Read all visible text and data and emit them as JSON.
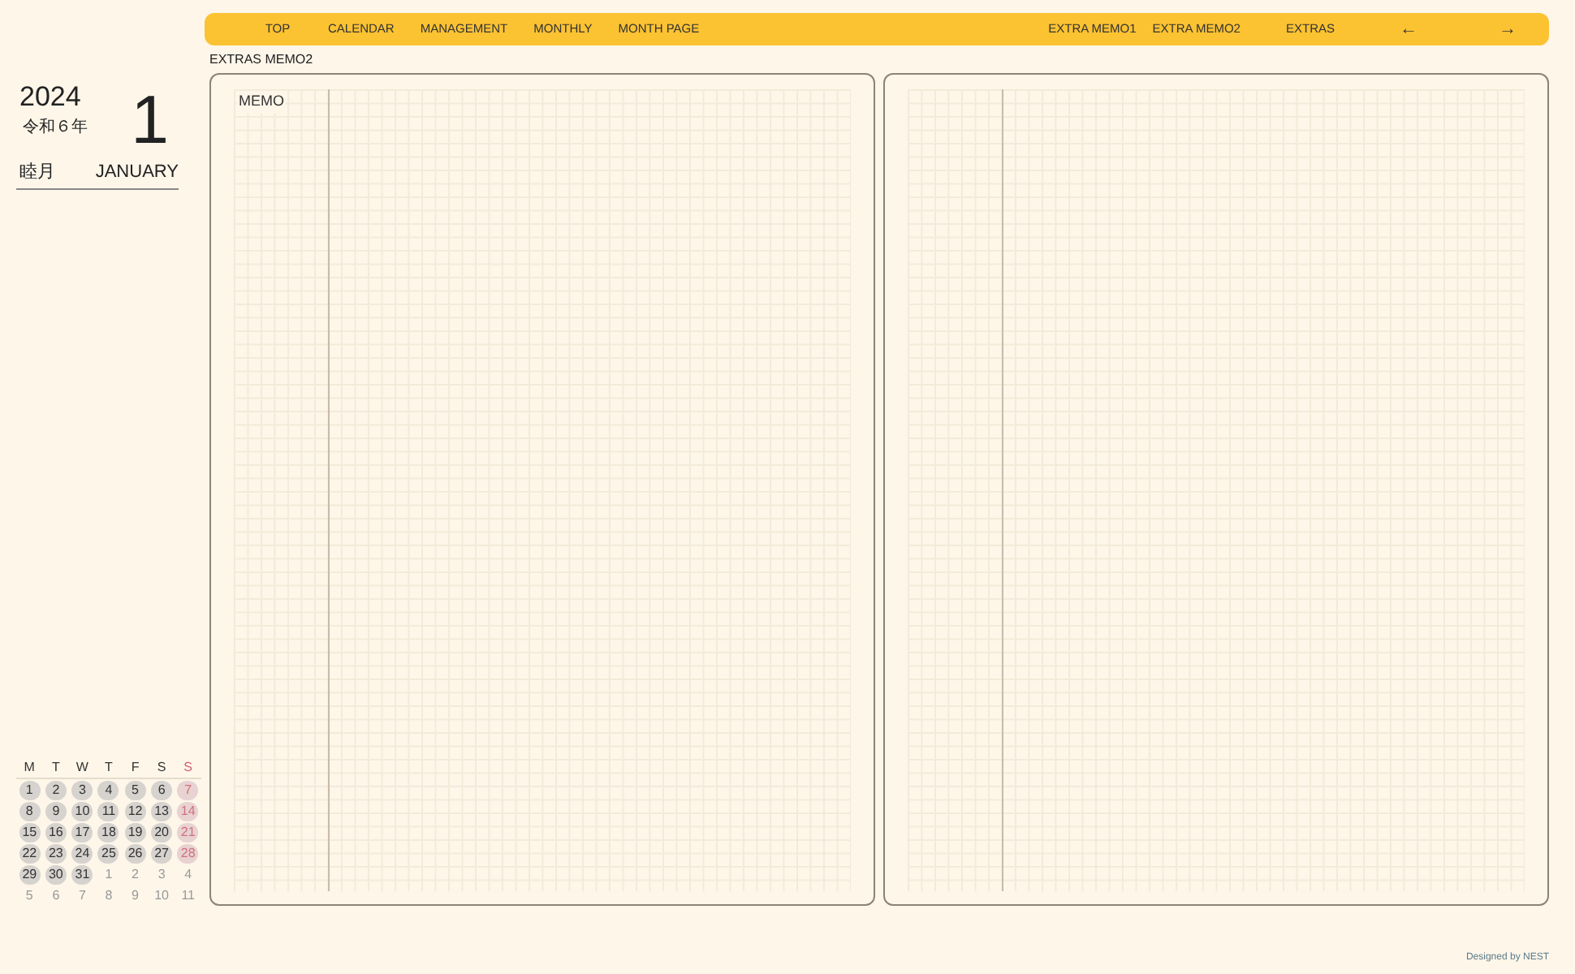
{
  "nav": {
    "left": [
      "TOP",
      "CALENDAR",
      "MANAGEMENT",
      "MONTHLY",
      "MONTH PAGE"
    ],
    "right": [
      "EXTRA MEMO1",
      "EXTRA MEMO2",
      "EXTRAS"
    ],
    "prev": "←",
    "next": "→"
  },
  "breadcrumb": "EXTRAS MEMO2",
  "sidebar": {
    "year": "2024",
    "era": "令和６年",
    "month_number": "1",
    "month_jp": "睦月",
    "month_en": "JANUARY"
  },
  "calendar": {
    "weekdays": [
      "M",
      "T",
      "W",
      "T",
      "F",
      "S",
      "S"
    ],
    "days": [
      {
        "label": "1",
        "kind": "current"
      },
      {
        "label": "2",
        "kind": "current"
      },
      {
        "label": "3",
        "kind": "current"
      },
      {
        "label": "4",
        "kind": "current"
      },
      {
        "label": "5",
        "kind": "current"
      },
      {
        "label": "6",
        "kind": "current"
      },
      {
        "label": "7",
        "kind": "current"
      },
      {
        "label": "8",
        "kind": "current"
      },
      {
        "label": "9",
        "kind": "current"
      },
      {
        "label": "10",
        "kind": "current"
      },
      {
        "label": "11",
        "kind": "current"
      },
      {
        "label": "12",
        "kind": "current"
      },
      {
        "label": "13",
        "kind": "current"
      },
      {
        "label": "14",
        "kind": "current"
      },
      {
        "label": "15",
        "kind": "current"
      },
      {
        "label": "16",
        "kind": "current"
      },
      {
        "label": "17",
        "kind": "current"
      },
      {
        "label": "18",
        "kind": "current"
      },
      {
        "label": "19",
        "kind": "current"
      },
      {
        "label": "20",
        "kind": "current"
      },
      {
        "label": "21",
        "kind": "current"
      },
      {
        "label": "22",
        "kind": "current"
      },
      {
        "label": "23",
        "kind": "current"
      },
      {
        "label": "24",
        "kind": "current"
      },
      {
        "label": "25",
        "kind": "current"
      },
      {
        "label": "26",
        "kind": "current"
      },
      {
        "label": "27",
        "kind": "current"
      },
      {
        "label": "28",
        "kind": "current"
      },
      {
        "label": "29",
        "kind": "current"
      },
      {
        "label": "30",
        "kind": "current"
      },
      {
        "label": "31",
        "kind": "current"
      },
      {
        "label": "1",
        "kind": "other"
      },
      {
        "label": "2",
        "kind": "other"
      },
      {
        "label": "3",
        "kind": "other"
      },
      {
        "label": "4",
        "kind": "other"
      },
      {
        "label": "5",
        "kind": "other"
      },
      {
        "label": "6",
        "kind": "other"
      },
      {
        "label": "7",
        "kind": "other"
      },
      {
        "label": "8",
        "kind": "other"
      },
      {
        "label": "9",
        "kind": "other"
      },
      {
        "label": "10",
        "kind": "other"
      },
      {
        "label": "11",
        "kind": "other"
      }
    ]
  },
  "pages": [
    {
      "kind": "titled",
      "title": "MEMO"
    },
    {
      "kind": "plain"
    }
  ],
  "footer": "Designed by NEST"
}
